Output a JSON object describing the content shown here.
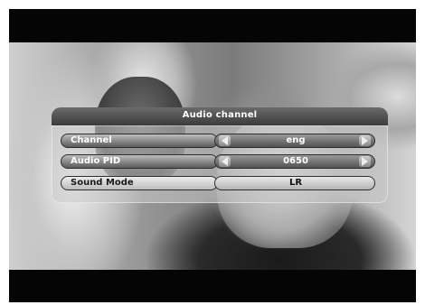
{
  "osd": {
    "title": "Audio channel",
    "rows": [
      {
        "label": "Channel",
        "value": "eng",
        "has_arrows": true,
        "selected": true
      },
      {
        "label": "Audio PID",
        "value": "0650",
        "has_arrows": true,
        "selected": true
      },
      {
        "label": "Sound Mode",
        "value": "LR",
        "has_arrows": false,
        "selected": false
      }
    ]
  },
  "icons": {
    "left_arrow": "triangle-left-icon",
    "right_arrow": "triangle-right-icon"
  },
  "colors": {
    "panel": "#c8c8c8",
    "title_bar": "#4a4a4a",
    "selected_pill": "#6e6e6e",
    "plain_pill": "#d6d6d6"
  }
}
